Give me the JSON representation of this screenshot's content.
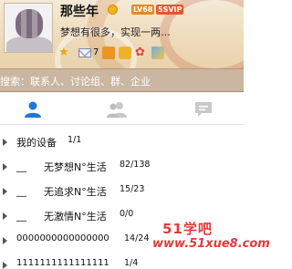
{
  "profile": {
    "nickname": "那些年",
    "level_badge": "LV68",
    "vip_badge": "5SVIP",
    "signature": "梦想有很多，实现一两…",
    "mail_count": "7"
  },
  "search": {
    "placeholder": "搜索：联系人、讨论组、群、企业"
  },
  "tabs": [
    {
      "name": "contacts",
      "icon": "person-icon",
      "active": true
    },
    {
      "name": "groups",
      "icon": "people-icon",
      "active": false
    },
    {
      "name": "recent",
      "icon": "chat-bubble-icon",
      "active": false
    }
  ],
  "groups": [
    {
      "label": "我的设备",
      "count": "1/1",
      "prefix": ""
    },
    {
      "label": "无梦想N°生活",
      "count": "82/138",
      "prefix": "__"
    },
    {
      "label": "无追求N°生活",
      "count": "15/23",
      "prefix": "__"
    },
    {
      "label": "无激情N°生活",
      "count": "0/0",
      "prefix": "__"
    },
    {
      "label": "0000000000000000",
      "count": "14/24",
      "prefix": ""
    },
    {
      "label": "1111111111111111",
      "count": "1/4",
      "prefix": ""
    }
  ],
  "watermark": {
    "line1": "51学吧",
    "line2": "www.51xue8.com"
  },
  "colors": {
    "accent": "#1e7ad3",
    "header_bg": "#f0dfc2",
    "search_bg": "#b89770",
    "watermark": "#e23a3a"
  }
}
